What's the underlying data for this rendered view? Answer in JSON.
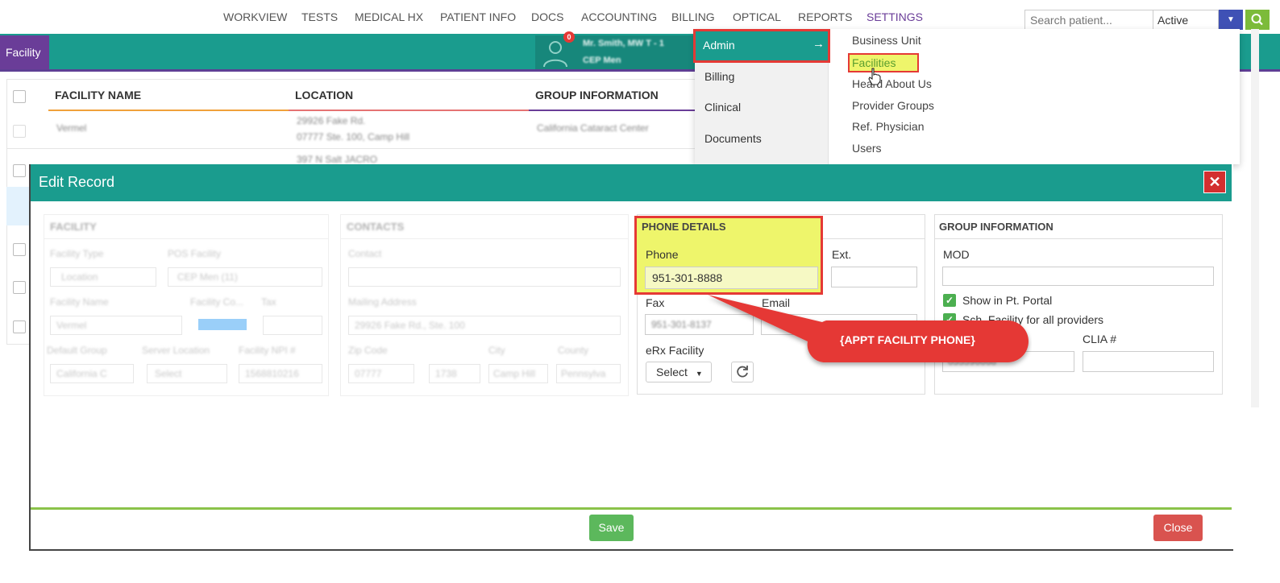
{
  "nav": {
    "items": [
      "WORKVIEW",
      "TESTS",
      "MEDICAL HX",
      "PATIENT INFO",
      "DOCS",
      "ACCOUNTING",
      "BILLING",
      "OPTICAL",
      "REPORTS",
      "SETTINGS"
    ],
    "search_placeholder": "Search patient...",
    "status_value": "Active"
  },
  "header": {
    "facility_tab": "Facility",
    "notification_count": "0",
    "patient_name": "Mr. Smith, MW T - 1",
    "patient_facility": "CEP Men"
  },
  "table": {
    "headers": [
      "FACILITY NAME",
      "LOCATION",
      "GROUP INFORMATION"
    ],
    "row1": {
      "name": "Vermel",
      "location_line1": "29926 Fake Rd.",
      "location_line2": "07777 Ste. 100, Camp Hill",
      "group": "California Cataract Center"
    },
    "row2": {
      "location_line1": "397 N Salt JACRO"
    }
  },
  "settings_menu": {
    "left": [
      "Admin",
      "Billing",
      "Clinical",
      "Documents"
    ],
    "right": [
      "Business Unit",
      "Facilities",
      "Heard About Us",
      "Provider Groups",
      "Ref. Physician",
      "Users"
    ]
  },
  "modal": {
    "title": "Edit Record",
    "close_x": "✕",
    "save": "Save",
    "close": "Close",
    "facility": {
      "heading": "FACILITY",
      "type_label": "Facility Type",
      "type_value": "Location",
      "pos_label": "POS Facility",
      "pos_value": "CEP Men (11)",
      "name_label": "Facility Name",
      "name_value": "Vermel",
      "color_label": "Facility Co...",
      "tax_label": "Tax",
      "group_label": "Default Group",
      "group_value": "California C",
      "server_label": "Server Location",
      "server_value": "Select",
      "npi_label": "Facility NPI #",
      "npi_value": "1568810216"
    },
    "contacts": {
      "heading": "CONTACTS",
      "contact_label": "Contact",
      "mailing_label": "Mailing Address",
      "mailing_value": "29926 Fake Rd., Ste. 100",
      "zip_label": "Zip Code",
      "zip_value": "07777",
      "zip_ext": "1738",
      "city_label": "City",
      "city_value": "Camp Hill",
      "county_label": "County",
      "county_value": "Pennsylva"
    },
    "phone": {
      "heading": "PHONE DETAILS",
      "phone_label": "Phone",
      "phone_value": "951-301-8888",
      "ext_label": "Ext.",
      "fax_label": "Fax",
      "fax_value": "951-301-8137",
      "email_label": "Email",
      "erx_label": "eRx Facility",
      "erx_value": "Select"
    },
    "group": {
      "heading": "GROUP INFORMATION",
      "mod_label": "MOD",
      "show_portal": "Show in Pt. Portal",
      "sch_facility": "Sch. Facility for all providers",
      "clia_label": "CLIA #",
      "left_value": "055596668"
    }
  },
  "callout": "{APPT FACILITY PHONE}"
}
